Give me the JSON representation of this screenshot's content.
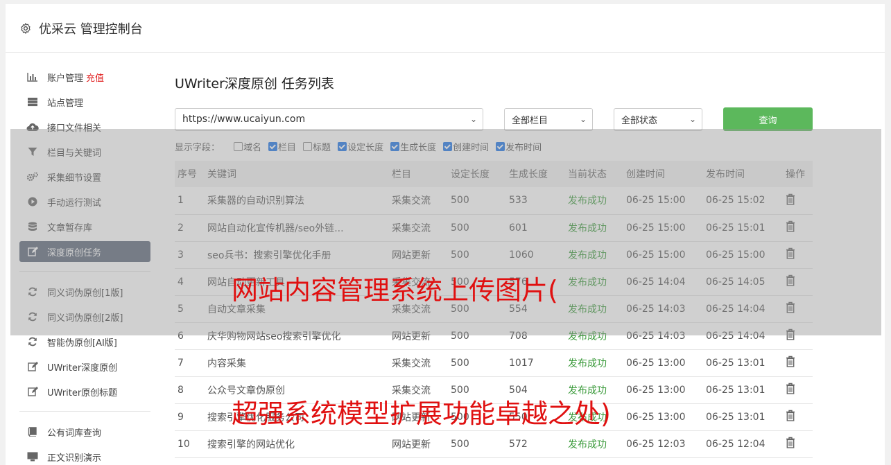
{
  "header": {
    "title": "优采云 管理控制台",
    "icon": "gear-icon"
  },
  "sidebar": {
    "items": [
      {
        "label": "账户管理",
        "extra": "充值",
        "icon": "bar-chart-icon"
      },
      {
        "label": "站点管理",
        "icon": "server-icon"
      },
      {
        "label": "接口文件相关",
        "icon": "cloud-upload-icon"
      },
      {
        "label": "栏目与关键词",
        "icon": "filter-icon"
      },
      {
        "label": "采集细节设置",
        "icon": "gears-icon"
      },
      {
        "label": "手动运行测试",
        "icon": "play-circle-icon"
      },
      {
        "label": "文章暂存库",
        "icon": "database-icon"
      },
      {
        "label": "深度原创任务",
        "icon": "edit-icon",
        "active": true
      },
      {
        "label": "同义词伪原创[1版]",
        "icon": "refresh-icon"
      },
      {
        "label": "同义词伪原创[2版]",
        "icon": "refresh-icon"
      },
      {
        "label": "智能伪原创[AI版]",
        "icon": "refresh-icon"
      },
      {
        "label": "UWriter深度原创",
        "icon": "edit-icon"
      },
      {
        "label": "UWriter原创标题",
        "icon": "edit-icon"
      },
      {
        "label": "公有词库查询",
        "icon": "book-icon"
      },
      {
        "label": "正文识别演示",
        "icon": "monitor-icon"
      }
    ]
  },
  "main": {
    "title": "UWriter深度原创 任务列表",
    "filters": {
      "site": "https://www.ucaiyun.com",
      "column": "全部栏目",
      "status": "全部状态",
      "query_label": "查询"
    },
    "fields": {
      "label": "显示字段：",
      "options": [
        {
          "label": "域名",
          "checked": false
        },
        {
          "label": "栏目",
          "checked": true
        },
        {
          "label": "标题",
          "checked": false
        },
        {
          "label": "设定长度",
          "checked": true
        },
        {
          "label": "生成长度",
          "checked": true
        },
        {
          "label": "创建时间",
          "checked": true
        },
        {
          "label": "发布时间",
          "checked": true
        }
      ]
    },
    "table": {
      "headers": [
        "序号",
        "关键词",
        "栏目",
        "设定长度",
        "生成长度",
        "当前状态",
        "创建时间",
        "发布时间",
        "操作"
      ],
      "rows": [
        [
          "1",
          "采集器的自动识别算法",
          "采集交流",
          "500",
          "533",
          "发布成功",
          "06-25 15:00",
          "06-25 15:02"
        ],
        [
          "2",
          "网站自动化宣传机器/seo外链...",
          "采集交流",
          "500",
          "601",
          "发布成功",
          "06-25 15:00",
          "06-25 15:01"
        ],
        [
          "3",
          "seo兵书：搜索引擎优化手册",
          "网站更新",
          "500",
          "1060",
          "发布成功",
          "06-25 15:00",
          "06-25 15:00"
        ],
        [
          "4",
          "网站自动更新工具",
          "采集交流",
          "500",
          "576",
          "发布成功",
          "06-25 14:04",
          "06-25 14:05"
        ],
        [
          "5",
          "自动文章采集",
          "采集交流",
          "500",
          "554",
          "发布成功",
          "06-25 14:03",
          "06-25 14:04"
        ],
        [
          "6",
          "庆华购物网站seo搜索引擎优化",
          "网站更新",
          "500",
          "708",
          "发布成功",
          "06-25 14:03",
          "06-25 14:04"
        ],
        [
          "7",
          "内容采集",
          "采集交流",
          "500",
          "1017",
          "发布成功",
          "06-25 13:00",
          "06-25 13:01"
        ],
        [
          "8",
          "公众号文章伪原创",
          "采集交流",
          "500",
          "504",
          "发布成功",
          "06-25 13:00",
          "06-25 13:01"
        ],
        [
          "9",
          "搜索引擎优化服务公司",
          "网站更新",
          "500",
          "550",
          "发布成功",
          "06-25 13:00",
          "06-25 13:01"
        ],
        [
          "10",
          "搜索引擎的网站优化",
          "网站更新",
          "500",
          "572",
          "发布成功",
          "06-25 12:03",
          "06-25 12:04"
        ]
      ]
    }
  },
  "watermark": {
    "line1": "网站内容管理系统上传图片(",
    "line2": "超强系统模型扩展功能卓越之处)"
  },
  "colors": {
    "accent_green": "#5cb85c",
    "active_sidebar": "#5c6779",
    "status_ok": "#3a9a3a",
    "watermark": "#e01010"
  }
}
